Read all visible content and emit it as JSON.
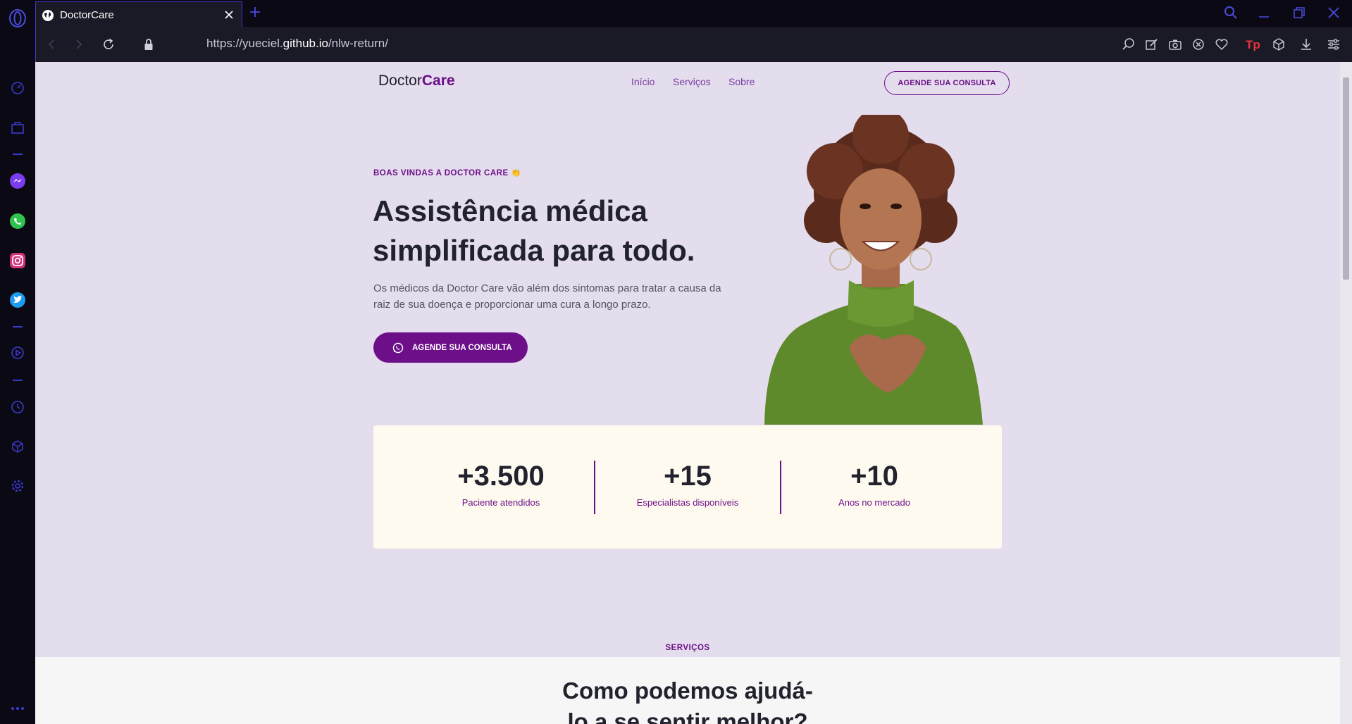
{
  "browser": {
    "tab_title": "DoctorCare",
    "url_prefix": "https://yueciel.",
    "url_host": "github.io",
    "url_path": "/nlw-return/",
    "icons": {
      "opera": "opera-logo-icon",
      "game": "gamepad-icon",
      "new_tab": "plus-icon",
      "search": "search-icon"
    }
  },
  "page": {
    "logo_part1": "Doctor",
    "logo_part2": "Care",
    "nav": [
      "Início",
      "Serviços",
      "Sobre"
    ],
    "header_cta": "AGENDE SUA CONSULTA",
    "hero": {
      "eyebrow": "BOAS VINDAS A DOCTOR CARE 👏",
      "title": "Assistência médica simplificada para todo.",
      "description": "Os médicos da Doctor Care vão além dos sintomas para tratar a causa da raiz de sua doença e proporcionar uma cura a longo prazo.",
      "cta": "AGENDE SUA CONSULTA"
    },
    "stats": [
      {
        "value": "+3.500",
        "label": "Paciente atendidos"
      },
      {
        "value": "+15",
        "label": "Especialistas disponíveis"
      },
      {
        "value": "+10",
        "label": "Anos no mercado"
      }
    ],
    "services": {
      "eyebrow": "SERVIÇOS",
      "title_line1": "Como podemos ajudá-",
      "title_line2": "lo a se sentir melhor?"
    }
  },
  "colors": {
    "brand": "#6c0f88",
    "page_bg": "#e4dded",
    "card_bg": "#fffaef",
    "browser_accent": "#3d3ac8"
  }
}
